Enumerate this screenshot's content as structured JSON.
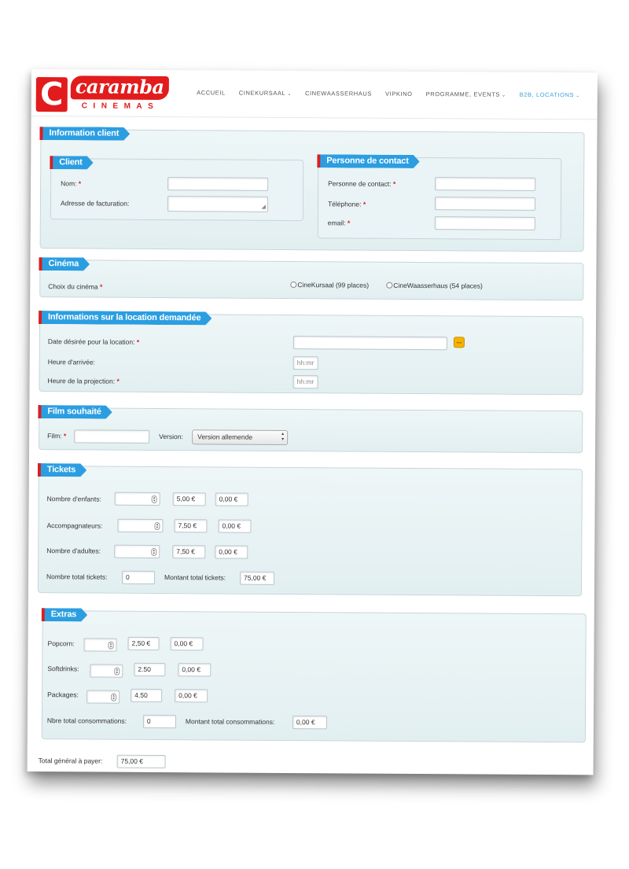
{
  "header": {
    "logo_letter": "C",
    "logo_word": "caramba",
    "logo_sub": "CINEMAS",
    "nav": [
      {
        "label": "ACCUEIL"
      },
      {
        "label": "CINEKURSAAL"
      },
      {
        "label": "CINEWAASSERHAUS"
      },
      {
        "label": "VIPKINO"
      },
      {
        "label": "PROGRAMME, EVENTS"
      },
      {
        "label": "B2B, LOCATIONS"
      }
    ],
    "accent_color": "#38a1d6"
  },
  "info_client": {
    "legend": "Information client",
    "client": {
      "legend": "Client",
      "nom_label": "Nom:",
      "adresse_label": "Adresse de facturation:"
    },
    "contact": {
      "legend": "Personne de contact",
      "personne_label": "Personne de contact:",
      "telephone_label": "Téléphone:",
      "email_label": "email:"
    }
  },
  "cinema": {
    "legend": "Cinéma",
    "choix_label": "Choix du cinéma",
    "options": [
      "CineKursaal (99 places)",
      "CineWaasserhaus (54 places)"
    ]
  },
  "location": {
    "legend": "Informations sur la location demandée",
    "date_label": "Date désirée pour la location:",
    "calendar_button": "...",
    "arrivee_label": "Heure d'arrivée:",
    "arrivee_placeholder": "hh:mr",
    "projection_label": "Heure de la projection:",
    "projection_placeholder": "hh:mr"
  },
  "film": {
    "legend": "Film souhaité",
    "film_label": "Film:",
    "version_label": "Version:",
    "version_value": "Version allemende"
  },
  "tickets": {
    "legend": "Tickets",
    "rows": [
      {
        "label": "Nombre d'enfants:",
        "price": "5,00 €",
        "total": "0,00 €"
      },
      {
        "label": "Accompagnateurs:",
        "price": "7,50 €",
        "total": "0,00 €"
      },
      {
        "label": "Nombre d'adultes:",
        "price": "7,50 €",
        "total": "0,00 €"
      }
    ],
    "total_tickets_label": "Nombre total tickets:",
    "total_tickets_value": "0",
    "montant_label": "Montant total tickets:",
    "montant_value": "75,00 €"
  },
  "extras": {
    "legend": "Extras",
    "rows": [
      {
        "label": "Popcorn:",
        "price": "2,50 €",
        "total": "0,00 €"
      },
      {
        "label": "Softdrinks:",
        "price": "2.50",
        "total": "0,00 €"
      },
      {
        "label": "Packages:",
        "price": "4.50",
        "total": "0,00 €"
      }
    ],
    "total_label": "Nbre total consommations:",
    "total_value": "0",
    "montant_label": "Montant total consommations:",
    "montant_value": "0,00 €"
  },
  "grand_total": {
    "label": "Total général à payer:",
    "value": "75,00 €"
  },
  "colors": {
    "legend_blue": "#2b9ee1",
    "brand_red": "#e21c1c",
    "required_red": "#d91f1f",
    "calendar_yellow": "#f5b400"
  }
}
